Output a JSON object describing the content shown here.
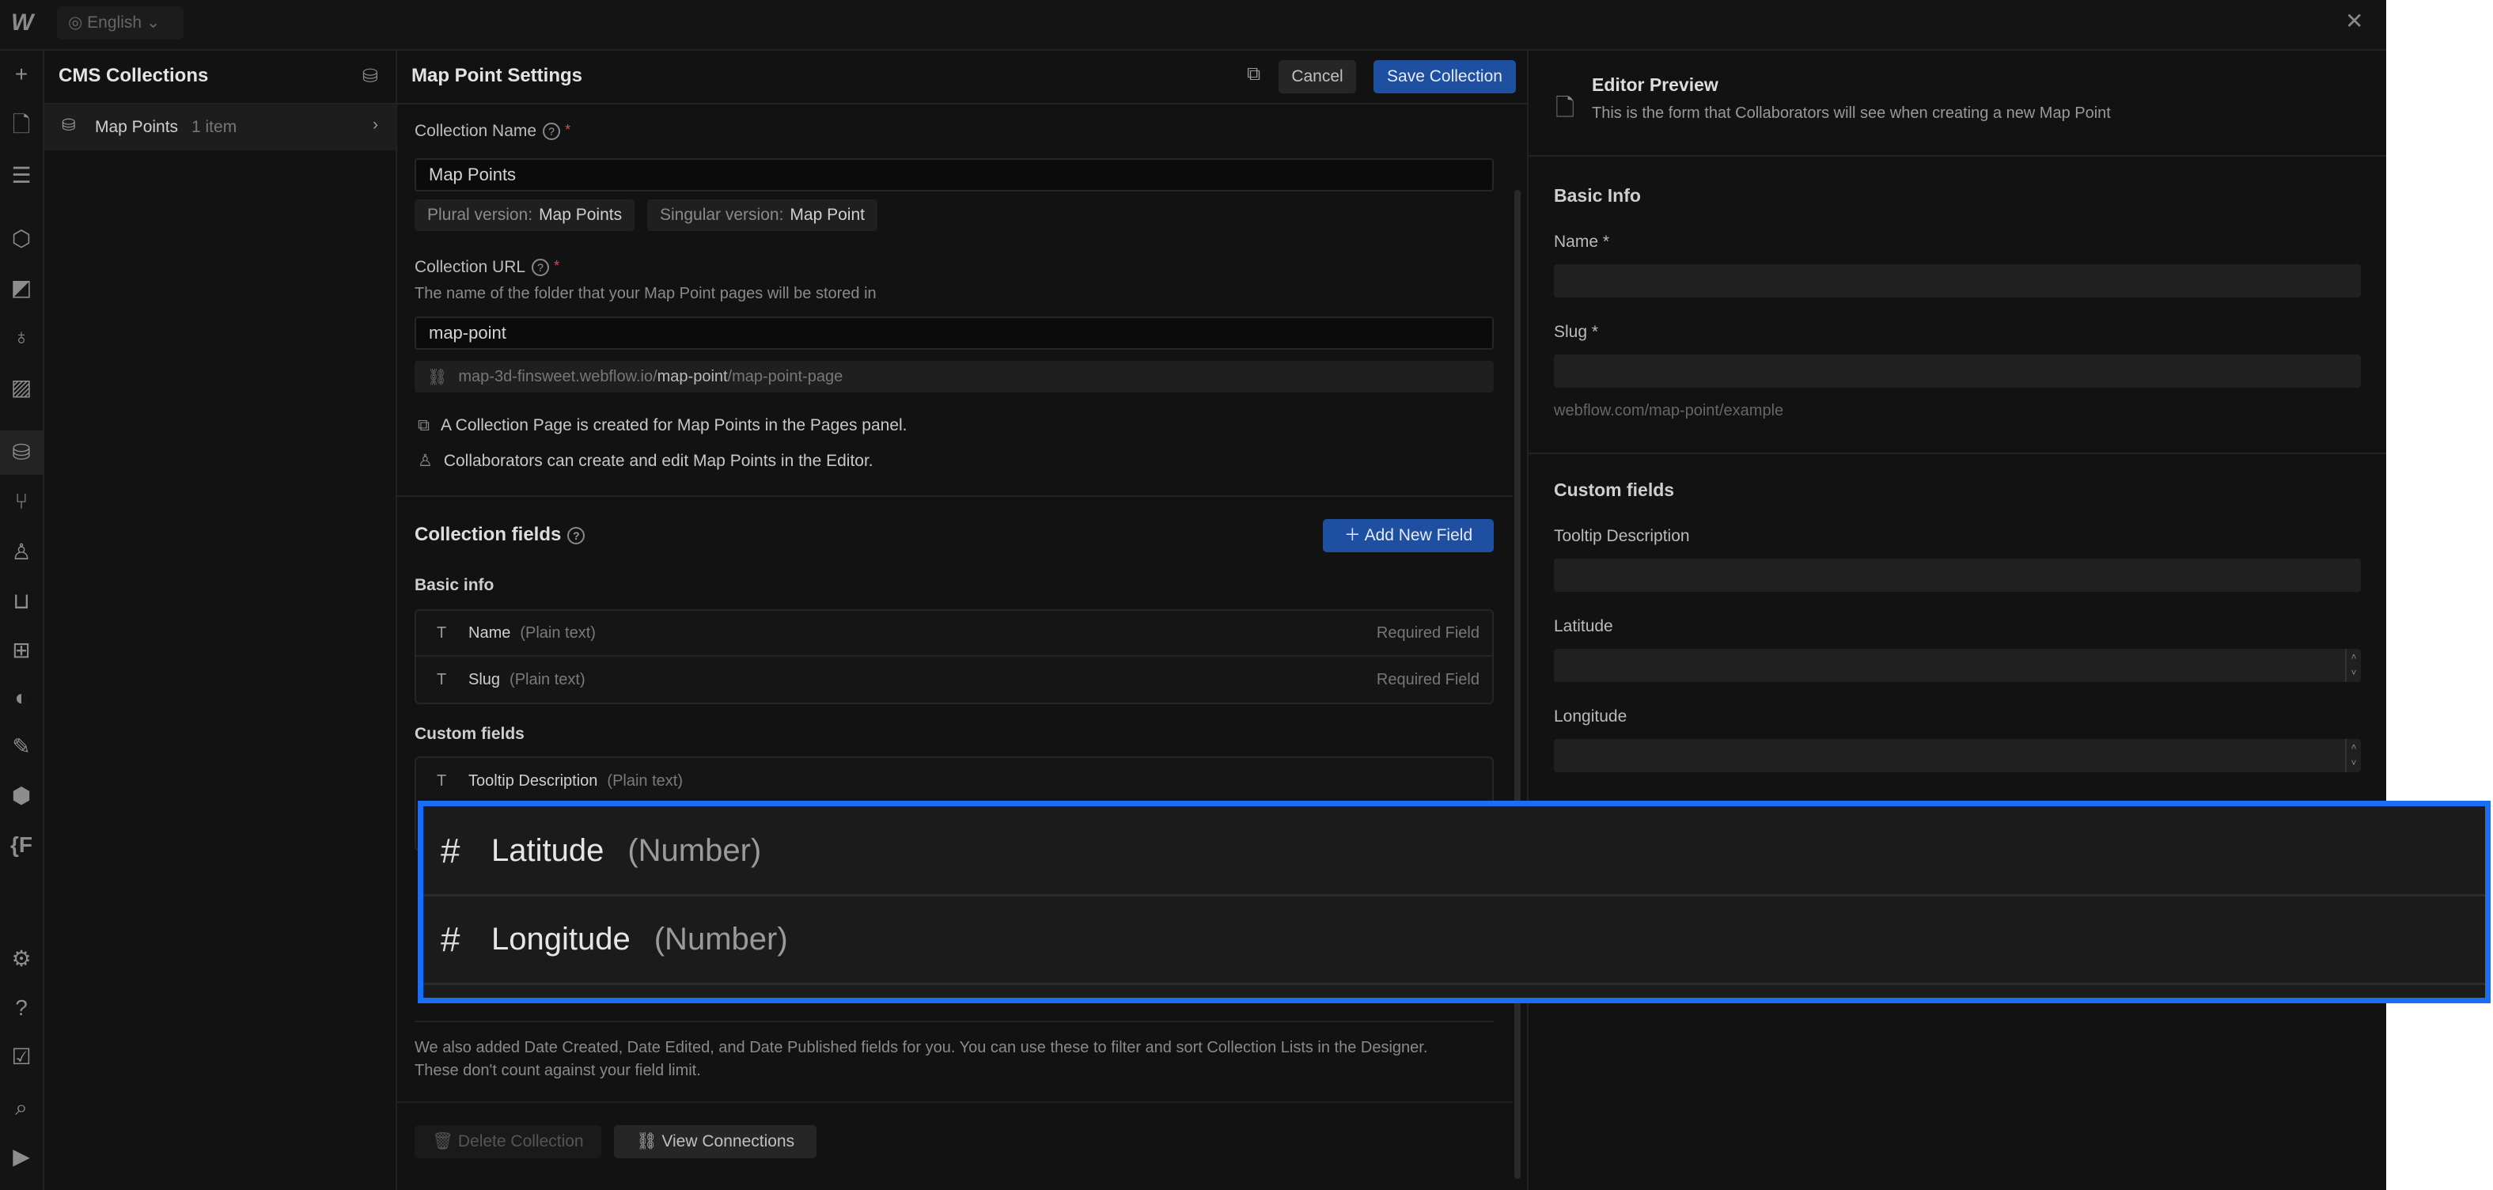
{
  "topbar": {
    "language": "English"
  },
  "rail": {
    "icons": [
      "add-icon",
      "pages-icon",
      "navigator-icon",
      "components-icon",
      "style-selectors-icon",
      "variables-icon",
      "assets-icon",
      "cms-icon",
      "logic-icon",
      "users-icon",
      "ecommerce-icon",
      "apps-icon",
      "localization-icon",
      "paint-icon",
      "3d-icon",
      "fonts-icon",
      "settings-icon",
      "help-icon",
      "audit-icon",
      "search-icon",
      "video-icon"
    ]
  },
  "cms": {
    "title": "CMS Collections",
    "items": [
      {
        "name": "Map Points",
        "count": "1 item"
      }
    ]
  },
  "settings": {
    "title": "Map Point Settings",
    "cancel": "Cancel",
    "save": "Save Collection",
    "collection_name_label": "Collection Name",
    "collection_name_value": "Map Points",
    "plural_label": "Plural version:",
    "plural_value": "Map Points",
    "singular_label": "Singular version:",
    "singular_value": "Map Point",
    "url_label": "Collection URL",
    "url_desc": "The name of the folder that your Map Point pages will be stored in",
    "url_value": "map-point",
    "url_preview_domain": "map-3d-finsweet.webflow.io/",
    "url_preview_folder": "map-point",
    "url_preview_page": "/map-point-page",
    "info1": "A Collection Page is created for Map Points in the Pages panel.",
    "info2": "Collaborators can create and edit Map Points in the Editor.",
    "fields_title": "Collection fields",
    "add_field": "Add New Field",
    "basic_info": "Basic info",
    "basic_fields": [
      {
        "name": "Name",
        "type": "(Plain text)",
        "note": "Required Field"
      },
      {
        "name": "Slug",
        "type": "(Plain text)",
        "note": "Required Field"
      }
    ],
    "custom_fields_label": "Custom fields",
    "custom_fields": [
      {
        "name": "Tooltip Description",
        "type": "(Plain text)"
      },
      {
        "name": "Latitude",
        "type": "(Number)"
      },
      {
        "name": "Longitude",
        "type": "(Number)"
      }
    ],
    "note": "We also added Date Created, Date Edited, and Date Published fields for you. You can use these to filter and sort Collection Lists in the Designer. These don't count against your field limit.",
    "delete": "Delete Collection",
    "view_connections": "View Connections"
  },
  "preview": {
    "title": "Editor Preview",
    "subtitle": "This is the form that Collaborators will see when creating a new Map Point",
    "basic_info": "Basic Info",
    "name_label": "Name *",
    "slug_label": "Slug *",
    "slug_hint": "webflow.com/map-point/example",
    "custom_fields": "Custom fields",
    "tooltip_label": "Tooltip Description",
    "latitude_label": "Latitude",
    "longitude_label": "Longitude"
  },
  "colors": {
    "accent": "#1f4fa0",
    "highlight": "#1a6ef5",
    "required": "#e0474a"
  }
}
